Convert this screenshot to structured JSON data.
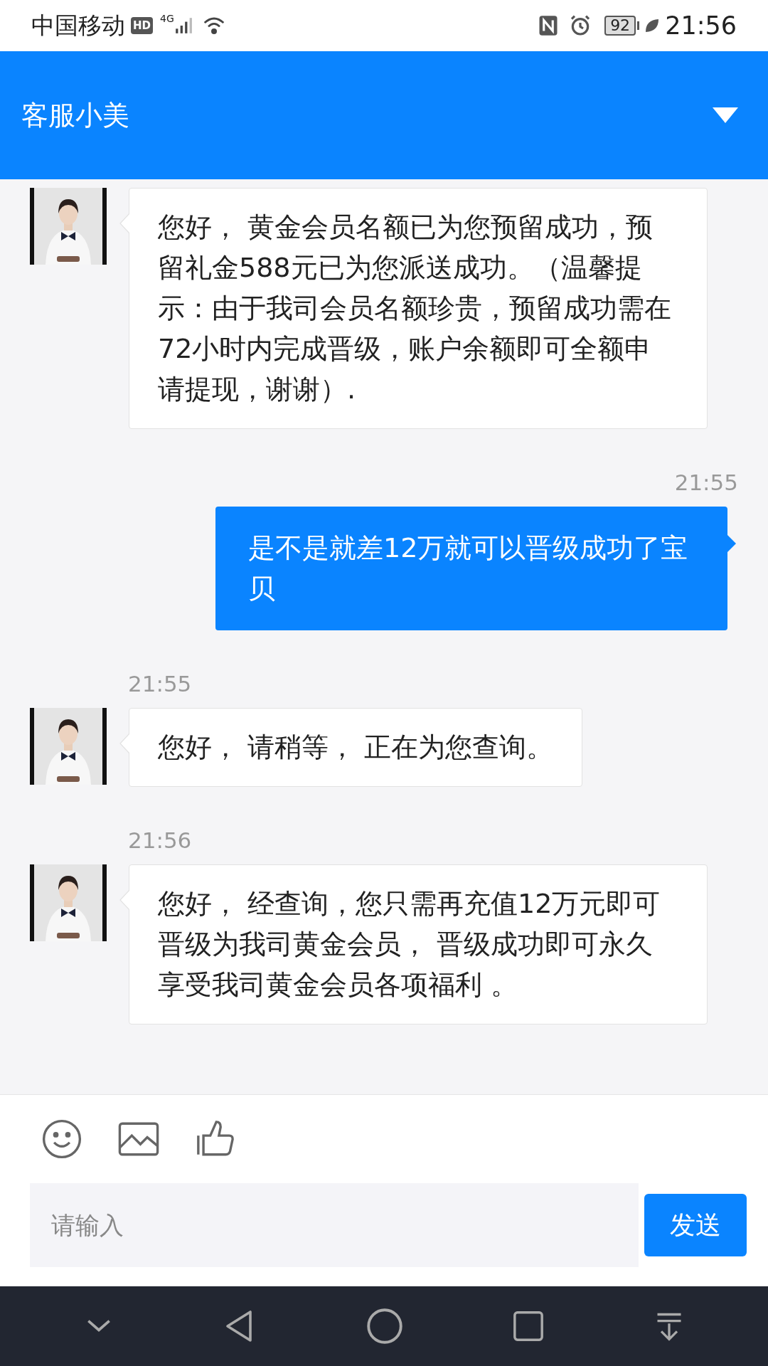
{
  "status_bar": {
    "carrier": "中国移动",
    "hd": "HD",
    "network": "4G",
    "battery": "92",
    "time": "21:56"
  },
  "header": {
    "title": "客服小美"
  },
  "messages": [
    {
      "kind": "incoming",
      "text": "您好， 黄金会员名额已为您预留成功，预留礼金588元已为您派送成功。（温馨提示：由于我司会员名额珍贵，预留成功需在72小时内完成晋级，账户余额即可全额申请提现，谢谢）."
    },
    {
      "kind": "outgoing",
      "time": "21:55",
      "text": "是不是就差12万就可以晋级成功了宝贝"
    },
    {
      "kind": "incoming",
      "time": "21:55",
      "text": "您好， 请稍等， 正在为您查询。"
    },
    {
      "kind": "incoming",
      "time": "21:56",
      "text": "您好， 经查询，您只需再充值12万元即可晋级为我司黄金会员， 晋级成功即可永久享受我司黄金会员各项福利 。"
    }
  ],
  "composer": {
    "placeholder": "请输入",
    "send": "发送"
  }
}
